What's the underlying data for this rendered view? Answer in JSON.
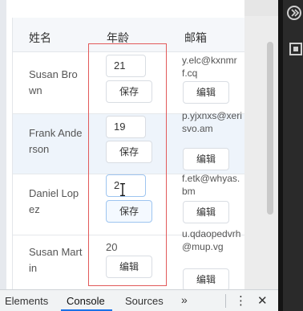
{
  "table": {
    "headers": {
      "name": "姓名",
      "age": "年龄",
      "email": "邮箱"
    },
    "rows": [
      {
        "name": "Susan Brown",
        "age": "21",
        "email": "y.elc@kxnmrf.cq",
        "save": "保存",
        "edit": "编辑"
      },
      {
        "name": "Frank Anderson",
        "age": "19",
        "email": "p.yjxnxs@xerisvo.am",
        "save": "保存",
        "edit": "编辑"
      },
      {
        "name": "Daniel Lopez",
        "age": "2",
        "email": "f.etk@whyas.bm",
        "save": "保存",
        "edit": "编辑"
      },
      {
        "name": "Susan Martin",
        "age": "20",
        "email": "u.qdaopedvrh@mup.vg",
        "edit": "编辑"
      }
    ]
  },
  "devtools": {
    "tabs": [
      "Elements",
      "Console",
      "Sources"
    ],
    "active_tab": "Console",
    "more": "»",
    "menu": "⋮",
    "close": "✕"
  },
  "colors": {
    "highlight_box": "#e25a5a",
    "accent": "#1a73e8",
    "row_hover": "#eef4fb"
  }
}
